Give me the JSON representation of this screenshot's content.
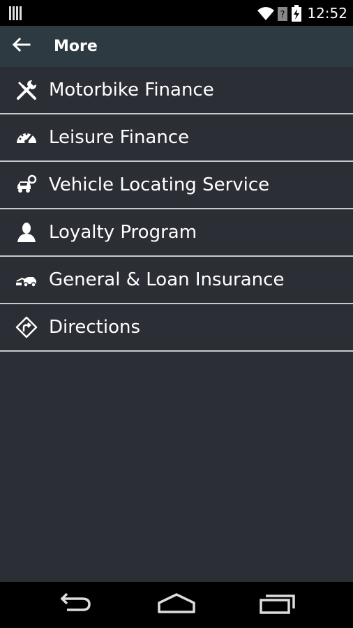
{
  "status_bar": {
    "time": "12:52",
    "icons": [
      "signal-bars-icon",
      "wifi-icon",
      "unknown-sim-icon",
      "battery-charging-icon"
    ]
  },
  "action_bar": {
    "title": "More",
    "back_icon": "back-arrow-icon"
  },
  "menu": {
    "items": [
      {
        "label": "Motorbike Finance",
        "icon": "tools-icon"
      },
      {
        "label": "Leisure Finance",
        "icon": "speedometer-icon"
      },
      {
        "label": "Vehicle Locating Service",
        "icon": "car-search-icon"
      },
      {
        "label": "Loyalty Program",
        "icon": "person-icon"
      },
      {
        "label": "General & Loan Insurance",
        "icon": "tow-truck-icon"
      },
      {
        "label": "Directions",
        "icon": "directions-sign-icon"
      }
    ]
  },
  "nav_bar": {
    "icons": [
      "back-nav-icon",
      "home-nav-icon",
      "recents-nav-icon"
    ]
  },
  "colors": {
    "background": "#2b2e35",
    "action_bar": "#2d3a42",
    "divider": "#c8cacc",
    "text": "#ffffff"
  }
}
